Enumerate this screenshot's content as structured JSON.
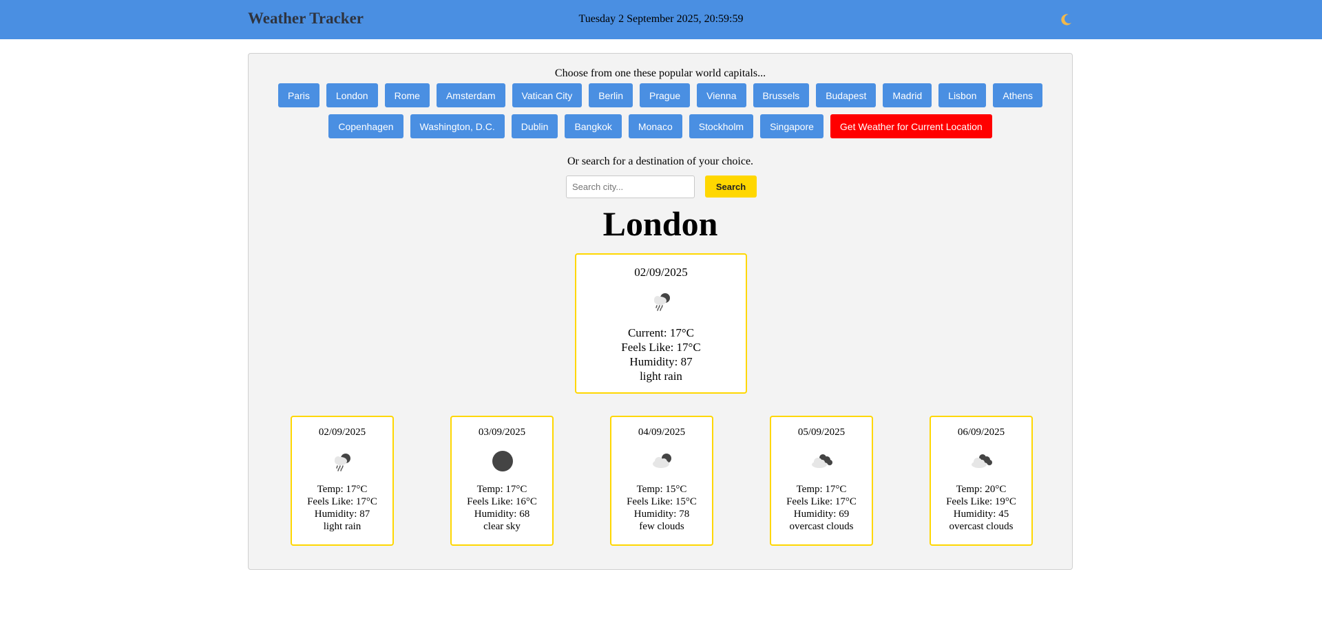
{
  "header": {
    "title": "Weather Tracker",
    "datetime": "Tuesday 2 September 2025, 20:59:59",
    "theme_icon": "moon-icon"
  },
  "capitals": {
    "prompt": "Choose from one these popular world capitals...",
    "row1": [
      "Paris",
      "London",
      "Rome",
      "Amsterdam",
      "Vatican City",
      "Berlin",
      "Prague",
      "Vienna",
      "Brussels",
      "Budapest",
      "Madrid",
      "Lisbon",
      "Athens"
    ],
    "row2": [
      "Copenhagen",
      "Washington, D.C.",
      "Dublin",
      "Bangkok",
      "Monaco",
      "Stockholm",
      "Singapore"
    ],
    "location_button": "Get Weather for Current Location"
  },
  "search": {
    "prompt": "Or search for a destination of your choice.",
    "placeholder": "Search city...",
    "button": "Search"
  },
  "city": "London",
  "current": {
    "date": "02/09/2025",
    "icon": "light-rain-icon",
    "current": "Current: 17°C",
    "feels_like": "Feels Like: 17°C",
    "humidity": "Humidity: 87",
    "description": "light rain"
  },
  "forecast": [
    {
      "date": "02/09/2025",
      "icon": "light-rain-icon",
      "temp": "Temp: 17°C",
      "feels_like": "Feels Like: 17°C",
      "humidity": "Humidity: 87",
      "description": "light rain"
    },
    {
      "date": "03/09/2025",
      "icon": "clear-sky-icon",
      "temp": "Temp: 17°C",
      "feels_like": "Feels Like: 16°C",
      "humidity": "Humidity: 68",
      "description": "clear sky"
    },
    {
      "date": "04/09/2025",
      "icon": "few-clouds-icon",
      "temp": "Temp: 15°C",
      "feels_like": "Feels Like: 15°C",
      "humidity": "Humidity: 78",
      "description": "few clouds"
    },
    {
      "date": "05/09/2025",
      "icon": "overcast-clouds-icon",
      "temp": "Temp: 17°C",
      "feels_like": "Feels Like: 17°C",
      "humidity": "Humidity: 69",
      "description": "overcast clouds"
    },
    {
      "date": "06/09/2025",
      "icon": "overcast-clouds-icon",
      "temp": "Temp: 20°C",
      "feels_like": "Feels Like: 19°C",
      "humidity": "Humidity: 45",
      "description": "overcast clouds"
    }
  ],
  "colors": {
    "header_bg": "#4a8fe2",
    "button_blue": "#4a8fe2",
    "button_red": "#ff0000",
    "search_yellow": "#ffd700",
    "card_border": "#ffd700",
    "panel_bg": "#f3f3f3"
  }
}
